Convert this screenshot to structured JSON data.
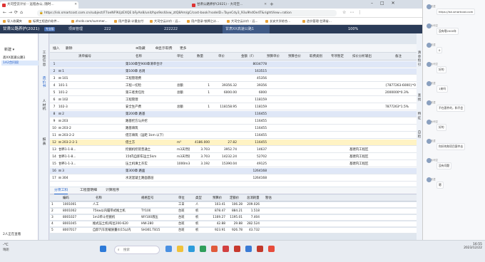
{
  "browser": {
    "tabs": [
      {
        "label": "大司空云计价 - 远程办公, 随时..."
      },
      {
        "label": "甘肃公路养护(2021) - 大司空..."
      }
    ],
    "url": "https://isk.smartcost.com.cn/subject/F7oeNF9UjzEXQE bFyAn8/unit/hps9sslUxw_ztQ8Am/gC/cost-book?nodeID=TayeCdy3_93u9hdOe4T&rightView=ration",
    "bookmarks": [
      "导入收藏夹",
      "标牌工程造价软件...",
      "zhcdz.com/summer...",
      "用户登录-计量支付",
      "大司空云计价 - 远...",
      "用户登录-铁牌之计...",
      "大司空云计价 - 远...",
      "长安大学综合...",
      "造价管理-甘肃省..."
    ]
  },
  "app": {
    "project": "甘肃公路养护(2021)",
    "badge": "专业版",
    "tabs": [
      "项目管理",
      "222",
      "222222",
      "甘肃XX高速公路1"
    ],
    "zoom": "100%"
  },
  "left": {
    "new_label": "新建",
    "items": [
      "高XX高速公路1",
      "1A2合同段"
    ],
    "status": "2人正在查看"
  },
  "vnav": [
    "工程信息",
    "造价书",
    "人材机",
    "报表"
  ],
  "toolbar": [
    "插入",
    "删除",
    "⊕隐藏",
    "✪显示",
    "取费",
    "更多"
  ],
  "grid": {
    "headers": [
      "清单编号",
      "名称",
      "单位",
      "数量",
      "单价",
      "金额（F）",
      "预算单价",
      "预算合价",
      "取费类别",
      "专项暂定",
      "扣价分析输出",
      "备注"
    ],
    "rows": [
      {
        "no": "1",
        "code": "",
        "name": "第100章至900章清单合计",
        "unit": "",
        "qty": "",
        "price": "",
        "amt": "8034778",
        "rem": "",
        "note": "",
        "cls": "hl"
      },
      {
        "no": "2",
        "code": "⊟ 1",
        "name": "第100章 总则",
        "unit": "",
        "qty": "",
        "price": "",
        "amt": "163515",
        "rem": "",
        "note": "",
        "cls": "hl"
      },
      {
        "no": "3",
        "code": "⊟ 101",
        "name": "工程管理费",
        "unit": "",
        "qty": "",
        "price": "",
        "amt": "45356",
        "rem": "",
        "note": "",
        "cls": ""
      },
      {
        "no": "4",
        "code": "101-1",
        "name": "工程一切险",
        "unit": "总额",
        "qty": "1",
        "price": "39356.32",
        "amt": "39356",
        "rem": "",
        "note": "{7877263-6000}*0",
        "cls": ""
      },
      {
        "no": "5",
        "code": "101-2",
        "name": "第三者责任险",
        "unit": "总额",
        "qty": "1",
        "price": "6000.00",
        "amt": "6000",
        "rem": "",
        "note": "2000000*0.3%",
        "cls": ""
      },
      {
        "no": "6",
        "code": "⊟ 102",
        "name": "工程管理",
        "unit": "",
        "qty": "",
        "price": "",
        "amt": "118159",
        "rem": "",
        "note": "",
        "cls": ""
      },
      {
        "no": "7",
        "code": "102-3",
        "name": "安全生产费",
        "unit": "总额",
        "qty": "1",
        "price": "118158.95",
        "amt": "118159",
        "rem": "",
        "note": "7877263*1.5%",
        "cls": ""
      },
      {
        "no": "8",
        "code": "⊟ 2",
        "name": "第200章 路基",
        "unit": "",
        "qty": "",
        "price": "",
        "amt": "116455",
        "rem": "",
        "note": "",
        "cls": "hl"
      },
      {
        "no": "9",
        "code": "⊟ 203",
        "name": "路基挖方与开挖",
        "unit": "",
        "qty": "",
        "price": "",
        "amt": "116455",
        "rem": "",
        "note": "",
        "cls": ""
      },
      {
        "no": "10",
        "code": "⊟ 203-2",
        "name": "路基填筑",
        "unit": "",
        "qty": "",
        "price": "",
        "amt": "116455",
        "rem": "",
        "note": "",
        "cls": ""
      },
      {
        "no": "11",
        "code": "⊟ 203-2-2",
        "name": "借方填筑（运距 1km 以下）",
        "unit": "",
        "qty": "",
        "price": "",
        "amt": "116455",
        "rem": "",
        "note": "",
        "cls": ""
      },
      {
        "no": "12",
        "code": "⊟ 203-2-2-1",
        "name": "借土方",
        "unit": "m³",
        "qty": "4186.000",
        "price": "27.82",
        "amt": "116455",
        "rem": "",
        "note": "",
        "cls": "cur"
      },
      {
        "no": "13",
        "code": "甘养1-1-8...",
        "name": "挖掘机挖装普通土",
        "unit": "m3天然密",
        "qty": "3.703",
        "price": "3952.74",
        "amt": "14637",
        "rem": "基建内工程区",
        "note": "",
        "cls": ""
      },
      {
        "no": "14",
        "code": "甘养1-1-8...",
        "name": "15t内自卸车运土5km",
        "unit": "m3天然密",
        "qty": "3.703",
        "price": "14232.24",
        "amt": "52702",
        "rem": "基建内工程区",
        "note": "",
        "cls": ""
      },
      {
        "no": "15",
        "code": "甘养1-1-3...",
        "name": "压土机填土夯实",
        "unit": "1000m3",
        "qty": "3.192",
        "price": "15390.04",
        "amt": "49125",
        "rem": "基建内工程区",
        "note": "",
        "cls": ""
      },
      {
        "no": "16",
        "code": "⊟ 3",
        "name": "第300章 路面",
        "unit": "",
        "qty": "",
        "price": "",
        "amt": "1264168",
        "rem": "",
        "note": "",
        "cls": "hl"
      },
      {
        "no": "17",
        "code": "⊟ 304",
        "name": "水泥混凝土路面基层",
        "unit": "",
        "qty": "",
        "price": "",
        "amt": "1264168",
        "rem": "",
        "note": "",
        "cls": ""
      }
    ]
  },
  "bottom": {
    "tabs": [
      "分项工料",
      "工程量明细",
      "计算程序"
    ],
    "headers": [
      "编码",
      "名称",
      "规格型号",
      "单位",
      "类型",
      "预算价",
      "定额价",
      "总消耗量",
      "暂估"
    ],
    "rows": [
      [
        "1",
        "1001001",
        "人工",
        "",
        "工日",
        "人",
        "103.41",
        "106.28",
        "209.026"
      ],
      [
        "2",
        "8001002",
        "75kw以内履带式推土机",
        "TY100",
        "台班",
        "机",
        "878.47",
        "884.21",
        "1.518"
      ],
      [
        "3",
        "8001027",
        "1m3单斗挖掘机",
        "WY100液压",
        "台班",
        "机",
        "1169.27",
        "1195.01",
        "7.404"
      ],
      [
        "4",
        "8001045",
        "推式压土机(吨位200-620",
        "HW-280",
        "台班",
        "机",
        "42.88",
        "29.88",
        "282.524"
      ],
      [
        "5",
        "8007017",
        "自卸汽车装载质量(t)15以内",
        "SH361.T815",
        "台班",
        "机",
        "923.91",
        "926.78",
        "43.732"
      ]
    ]
  },
  "rightbar": [
    "清单指引",
    "查找",
    "特征",
    "自检"
  ],
  "chat": {
    "items": [
      {
        "name": "天涯",
        "text": "https://isk.smartcost.com"
      },
      {
        "name": "大司空",
        "text": "没有哦2000年"
      },
      {
        "name": "天涯",
        "text": "0"
      },
      {
        "name": "大司空",
        "text": "好的"
      },
      {
        "name": "天涯",
        "text": "1来吗"
      },
      {
        "name": "天涯",
        "text": "不在客件的，和不会"
      },
      {
        "name": "大司空",
        "text": "好的"
      },
      {
        "name": "天涯",
        "text": "你好的和项目客件去"
      },
      {
        "name": "大司空",
        "text": "没有问题"
      },
      {
        "name": "天涯",
        "text": "嗯"
      }
    ]
  },
  "taskbar": {
    "weather": "-°C",
    "weather_sub": "晴朗",
    "search": "搜索",
    "time": "16:55",
    "date": "2023/12/22"
  }
}
